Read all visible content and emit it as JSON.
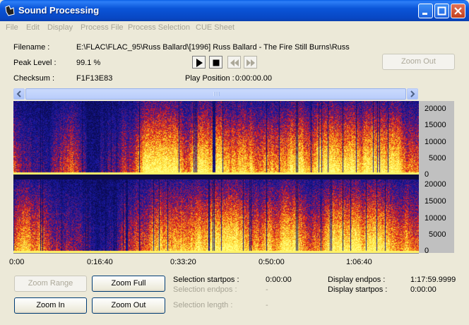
{
  "window": {
    "title": "Sound Processing"
  },
  "menu": [
    "File",
    "Edit",
    "Display",
    "Process File",
    "Process Selection",
    "CUE Sheet"
  ],
  "info": {
    "filename_label": "Filename :",
    "filename_value": "E:\\FLAC\\FLAC_95\\Russ Ballard\\[1996] Russ Ballard - The Fire Still Burns\\Russ",
    "peak_label": "Peak Level :",
    "peak_value": "99.1 %",
    "checksum_label": "Checksum :",
    "checksum_value": "F1F13E83",
    "play_position_label": "Play Position :",
    "play_position_value": "0:00:00.00"
  },
  "transport": {
    "play": "play-icon",
    "stop": "stop-icon",
    "rewind": "rewind-icon",
    "fast_forward": "fast-forward-icon"
  },
  "buttons": {
    "zoom_out_top": "Zoom Out",
    "zoom_range": "Zoom Range",
    "zoom_full": "Zoom Full",
    "zoom_in": "Zoom In",
    "zoom_out": "Zoom Out"
  },
  "spectrogram": {
    "y_ticks": [
      "20000",
      "15000",
      "10000",
      "5000",
      "0"
    ],
    "x_ticks": [
      "0:00",
      "0:16:40",
      "0:33:20",
      "0:50:00",
      "1:06:40"
    ],
    "colors": {
      "low": "#1a1aa8",
      "mid": "#e01818",
      "high": "#ffd020",
      "peak": "#ffff80"
    }
  },
  "selection": {
    "startpos_label": "Selection startpos :",
    "startpos_value": "0:00:00",
    "endpos_label": "Selection endpos :",
    "endpos_value": "-",
    "length_label": "Selection length :",
    "length_value": "-"
  },
  "display": {
    "endpos_label": "Display endpos :",
    "endpos_value": "1:17:59.9999",
    "startpos_label": "Display startpos :",
    "startpos_value": "0:00:00"
  }
}
